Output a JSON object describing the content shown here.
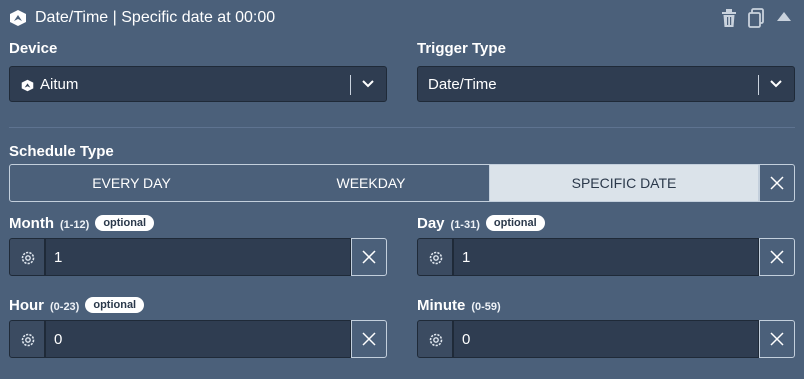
{
  "header": {
    "title": "Date/Time | Specific date at 00:00",
    "icons": [
      "trash-icon",
      "copy-icon",
      "collapse-icon"
    ]
  },
  "device": {
    "label": "Device",
    "value": "Aitum"
  },
  "trigger_type": {
    "label": "Trigger Type",
    "value": "Date/Time"
  },
  "schedule": {
    "label": "Schedule Type",
    "options": [
      "EVERY DAY",
      "WEEKDAY",
      "SPECIFIC DATE"
    ],
    "selected": "SPECIFIC DATE"
  },
  "fields": {
    "month": {
      "label": "Month",
      "range": "(1-12)",
      "badge": "optional",
      "value": "1"
    },
    "day": {
      "label": "Day",
      "range": "(1-31)",
      "badge": "optional",
      "value": "1"
    },
    "hour": {
      "label": "Hour",
      "range": "(0-23)",
      "badge": "optional",
      "value": "0"
    },
    "minute": {
      "label": "Minute",
      "range": "(0-59)",
      "value": "0"
    }
  },
  "colors": {
    "panel_bg": "#4b607a",
    "input_bg": "#2f3d51",
    "selected_segment_bg": "#dbe3ea",
    "border": "#c3cfdc"
  }
}
